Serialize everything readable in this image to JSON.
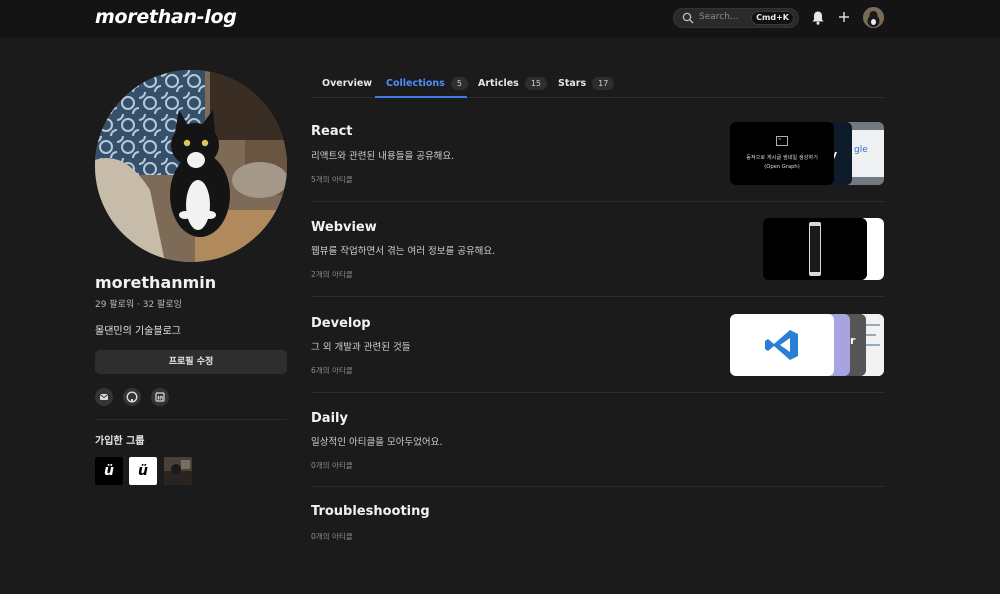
{
  "header": {
    "logo": "morethan-log",
    "search_placeholder": "Search...",
    "search_shortcut": "Cmd+K",
    "icons": [
      "search-icon",
      "bell-icon",
      "plus-icon",
      "avatar"
    ]
  },
  "profile": {
    "username": "morethanmin",
    "follow_text": "29 팔로워 · 32 팔로잉",
    "bio": "몰댄민의 기술블로그",
    "edit_button": "프로필 수정",
    "social_icons": [
      "mail-icon",
      "github-icon",
      "linkedin-icon"
    ],
    "groups_heading": "가입한 그룹",
    "groups": [
      {
        "label": "ü",
        "style": "dark"
      },
      {
        "label": "ü",
        "style": "light"
      },
      {
        "label": "",
        "style": "photo"
      }
    ]
  },
  "tabs": [
    {
      "label": "Overview",
      "count": null,
      "active": false
    },
    {
      "label": "Collections",
      "count": "5",
      "active": true
    },
    {
      "label": "Articles",
      "count": "15",
      "active": false
    },
    {
      "label": "Stars",
      "count": "17",
      "active": false
    }
  ],
  "collections": [
    {
      "title": "React",
      "description": "리액트와 관련된 내용들을 공유해요.",
      "count": "5개의 아티클",
      "thumb_caption_1": "동적으로 게시글 썸네일 생성하기",
      "thumb_caption_2": "(Open Graph)"
    },
    {
      "title": "Webview",
      "description": "웹뷰를 작업하면서 겪는 여러 정보를 공유해요.",
      "count": "2개의 아티클"
    },
    {
      "title": "Develop",
      "description": "그 외 개발과 관련된 것들",
      "count": "6개의 아티클"
    },
    {
      "title": "Daily",
      "description": "일상적인 아티클을 모아두었어요.",
      "count": "0개의 아티클"
    },
    {
      "title": "Troubleshooting",
      "description": "",
      "count": "0개의 아티클"
    }
  ],
  "colors": {
    "background": "#1b1b1b",
    "topbar": "#141414",
    "accent": "#3b7ddd",
    "vscode_blue": "#2a7fd4"
  }
}
